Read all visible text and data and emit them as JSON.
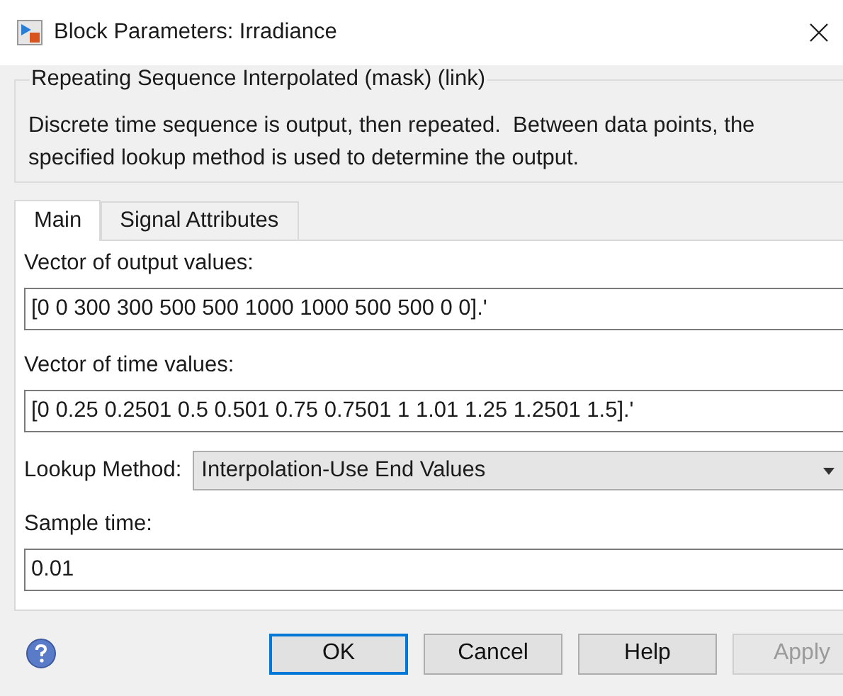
{
  "window": {
    "title": "Block Parameters: Irradiance"
  },
  "group": {
    "title": "Repeating Sequence Interpolated (mask) (link)",
    "description": "Discrete time sequence is output, then repeated.  Between data points, the specified lookup method is used to determine the output."
  },
  "tabs": [
    {
      "label": "Main",
      "selected": true
    },
    {
      "label": "Signal Attributes",
      "selected": false
    }
  ],
  "params": [
    {
      "kind": "text",
      "label": "Vector of output values:",
      "value": "[0 0 300 300 500 500 1000 1000 500 500 0 0].'"
    },
    {
      "kind": "text",
      "label": "Vector of time values:",
      "value": "[0 0.25 0.2501 0.5 0.501 0.75 0.7501 1 1.01 1.25 1.2501 1.5].'"
    },
    {
      "kind": "dropdown",
      "label": "Lookup Method:",
      "value": "Interpolation-Use End Values"
    },
    {
      "kind": "text",
      "label": "Sample time:",
      "value": "0.01"
    }
  ],
  "buttons": [
    {
      "label": "OK",
      "default": true,
      "disabled": false
    },
    {
      "label": "Cancel",
      "default": false,
      "disabled": false
    },
    {
      "label": "Help",
      "default": false,
      "disabled": false
    },
    {
      "label": "Apply",
      "default": false,
      "disabled": true
    }
  ]
}
